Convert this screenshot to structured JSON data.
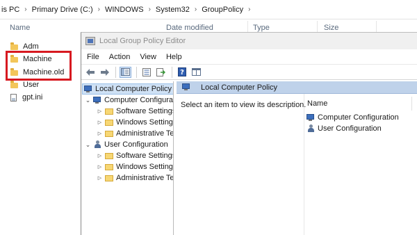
{
  "explorer": {
    "breadcrumb": [
      "is PC",
      "Primary Drive (C:)",
      "WINDOWS",
      "System32",
      "GroupPolicy"
    ],
    "columns": {
      "name": "Name",
      "date": "Date modified",
      "type": "Type",
      "size": "Size"
    },
    "files": [
      {
        "label": "Adm",
        "icon": "folder-icon"
      },
      {
        "label": "Machine",
        "icon": "folder-icon"
      },
      {
        "label": "Machine.old",
        "icon": "folder-icon"
      },
      {
        "label": "User",
        "icon": "folder-icon"
      },
      {
        "label": "gpt.ini",
        "icon": "file-icon"
      }
    ],
    "highlight_color": "#d71920"
  },
  "gpedit": {
    "title": "Local Group Policy Editor",
    "menu": [
      "File",
      "Action",
      "View",
      "Help"
    ],
    "toolbar": [
      "back-icon",
      "forward-icon",
      "show-tree-icon",
      "properties-icon",
      "export-list-icon",
      "help-icon",
      "view-icon"
    ],
    "tree": {
      "root": "Local Computer Policy",
      "computer": "Computer Configura",
      "computer_children": [
        "Software Settings",
        "Windows Setting",
        "Administrative Te"
      ],
      "user": "User Configuration",
      "user_children": [
        "Software Settings",
        "Windows Setting",
        "Administrative Te"
      ]
    },
    "right": {
      "header": "Local Computer Policy",
      "description": "Select an item to view its description.",
      "list_header": "Name",
      "items": [
        "Computer Configuration",
        "User Configuration"
      ]
    },
    "colors": {
      "header_bg": "#bfd2ea",
      "selected_bg": "#cfe1f5"
    }
  }
}
